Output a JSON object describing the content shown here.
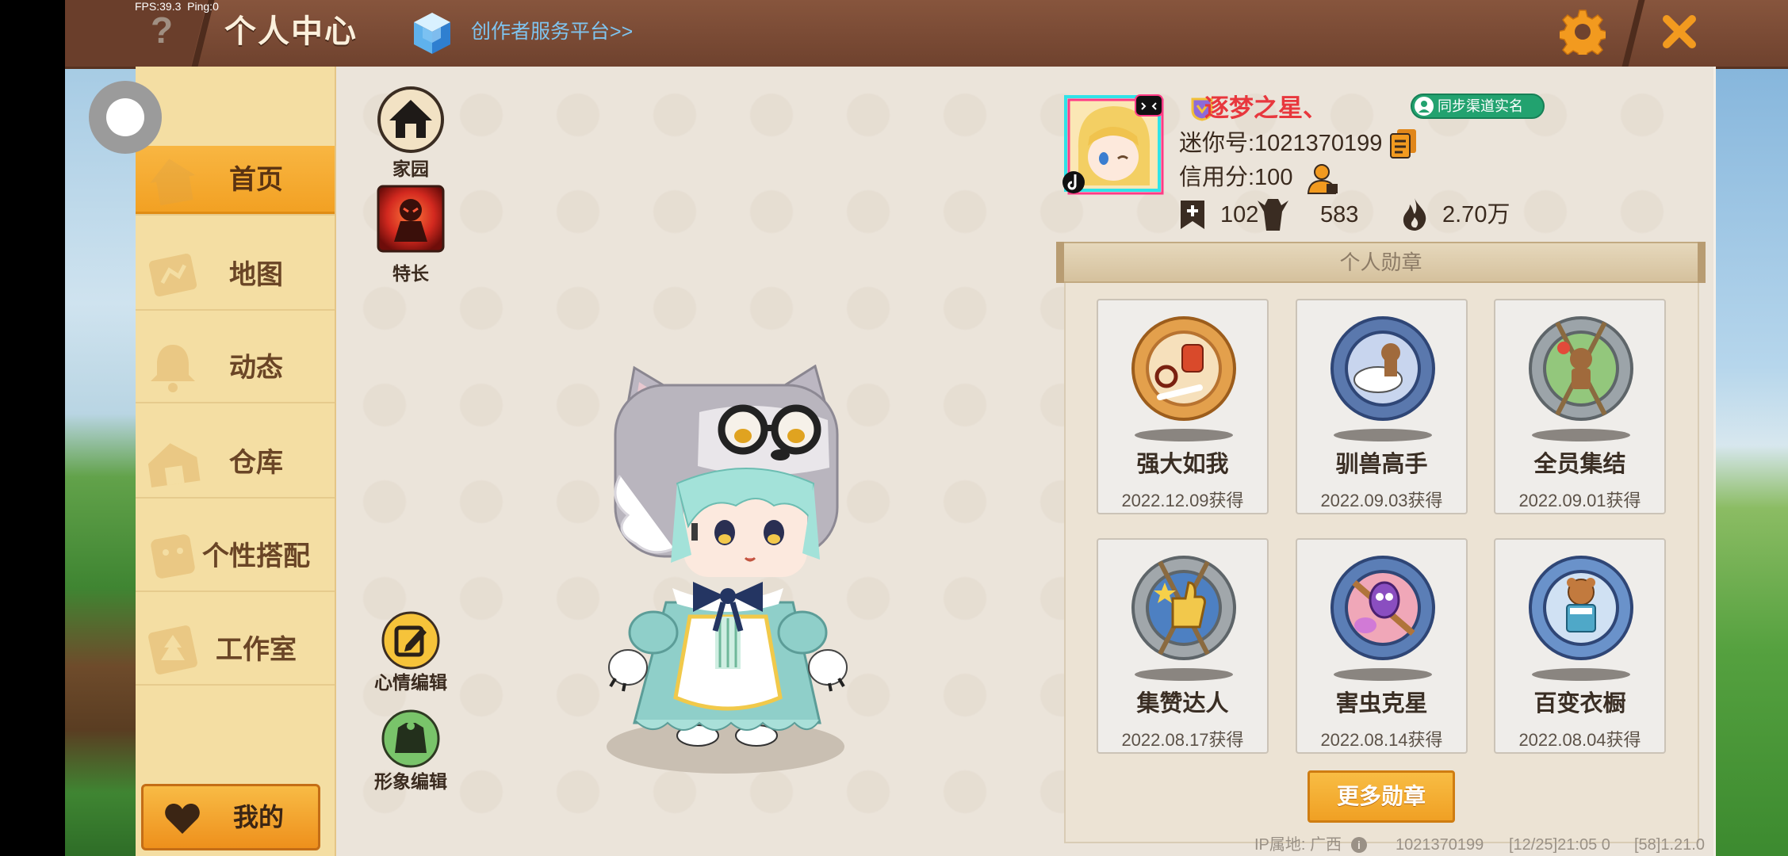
{
  "status_bar": {
    "fps": "FPS:39.3",
    "ping": "Ping:0"
  },
  "header": {
    "help_icon": "question-icon",
    "title": "个人中心",
    "creator_icon": "cube-icon",
    "creator_link": "创作者服务平台>>",
    "settings_icon": "gear-icon",
    "close_icon": "close-icon"
  },
  "sidebar": {
    "items": [
      {
        "label": "首页",
        "icon": "house-icon",
        "active": true
      },
      {
        "label": "地图",
        "icon": "map-icon",
        "active": false
      },
      {
        "label": "动态",
        "icon": "bell-icon",
        "active": false
      },
      {
        "label": "仓库",
        "icon": "warehouse-icon",
        "active": false
      },
      {
        "label": "个性搭配",
        "icon": "outfit-icon",
        "active": false
      },
      {
        "label": "工作室",
        "icon": "studio-icon",
        "active": false
      }
    ],
    "my_button": {
      "label": "我的",
      "icon": "heart-icon"
    }
  },
  "quick_actions": [
    {
      "label": "家园",
      "icon": "home-icon"
    },
    {
      "label": "特长",
      "icon": "talent-icon"
    }
  ],
  "edit_actions": [
    {
      "label": "心情编辑",
      "icon": "mood-edit-icon"
    },
    {
      "label": "形象编辑",
      "icon": "appearance-edit-icon"
    }
  ],
  "profile": {
    "name": "逐梦之星、",
    "sync_button": "同步渠道实名",
    "mini_id": "迷你号:1021370199",
    "credit": "信用分:100",
    "stats": {
      "collections": "102",
      "likes": "583",
      "popularity": "2.70万"
    }
  },
  "medals": {
    "title": "个人勋章",
    "items": [
      {
        "name": "强大如我",
        "date": "2022.12.09获得",
        "icon": "fist-medal-icon",
        "ring_color": "#e3a04c",
        "face_color": "#f6e0bb"
      },
      {
        "name": "驯兽高手",
        "date": "2022.09.03获得",
        "icon": "beast-tamer-medal-icon",
        "ring_color": "#5a78ad",
        "face_color": "#c8d5ee"
      },
      {
        "name": "全员集结",
        "date": "2022.09.01获得",
        "icon": "team-medal-icon",
        "ring_color": "#9ca4a9",
        "face_color": "#93c77c"
      },
      {
        "name": "集赞达人",
        "date": "2022.08.17获得",
        "icon": "thumbs-up-medal-icon",
        "ring_color": "#a1a7ab",
        "face_color": "#4d80c2"
      },
      {
        "name": "害虫克星",
        "date": "2022.08.14获得",
        "icon": "bug-medal-icon",
        "ring_color": "#5b7eb6",
        "face_color": "#f0a7b8"
      },
      {
        "name": "百变衣橱",
        "date": "2022.08.04获得",
        "icon": "wardrobe-medal-icon",
        "ring_color": "#6a92ca",
        "face_color": "#d0e1f3"
      }
    ],
    "more_button": "更多勋章"
  },
  "footer": {
    "ip": "IP属地: 广西",
    "uid": "1021370199",
    "time": "[12/25]21:05 0",
    "version": "[58]1.21.0"
  },
  "colors": {
    "header": "#7a4a33",
    "sidebar": "#f4dea3",
    "active_tab": "#f5a524",
    "name": "#e8373d",
    "sync_badge": "#22a26f",
    "accent": "#f29a1f"
  }
}
